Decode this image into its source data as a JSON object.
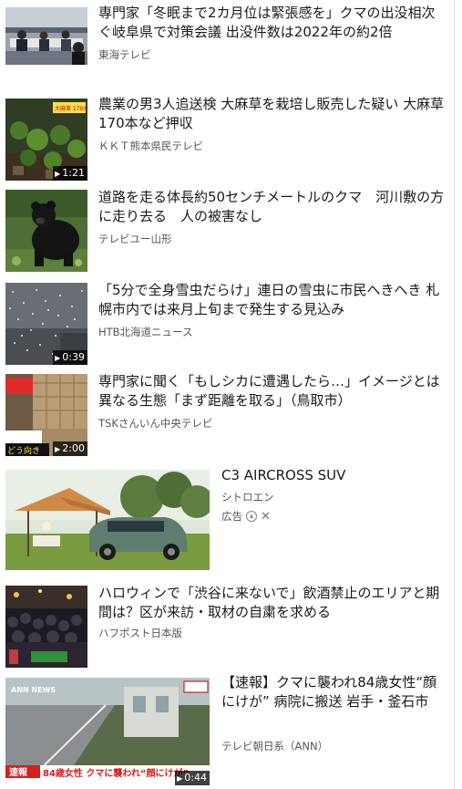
{
  "articles": [
    {
      "title": "専門家「冬眠まで2カ月位は緊張感を」クマの出没相次ぐ岐阜県で対策会議 出没件数は2022年の約2倍",
      "source": "東海テレビ",
      "duration": ""
    },
    {
      "title": "農業の男3人追送検 大麻草を栽培し販売した疑い 大麻草170本など押収",
      "source": "ＫＫＴ熊本県民テレビ",
      "duration": "1:21",
      "thumb_caption": "大麻草 170本押収"
    },
    {
      "title": "道路を走る体長約50センチメートルのクマ　河川敷の方に走り去る　人の被害なし",
      "source": "テレビユー山形",
      "duration": ""
    },
    {
      "title": "「5分で全身雪虫だらけ」連日の雪虫に市民へきへき 札幌市内では来月上旬まで発生する見込み",
      "source": "HTB北海道ニュース",
      "duration": "0:39"
    },
    {
      "title": "専門家に聞く「もしシカに遭遇したら…」イメージとは異なる生態「まず距離を取る」（鳥取市）",
      "source": "TSKさんいん中央テレビ",
      "duration": "2:00",
      "thumb_caption": "どう向き"
    },
    {
      "title": "ハロウィンで「渋谷に来ないで」飲酒禁止のエリアと期間は？区が来訪・取材の自粛を求める",
      "source": "ハフポスト日本版",
      "duration": ""
    },
    {
      "title": "【速報】クマに襲われ84歳女性“顔にけが” 病院に搬送 岩手・釜石市",
      "source": "テレビ朝日系（ANN）",
      "duration": "0:44",
      "thumb_caption": "84歳女性 クマに襲われ“顔にけが”",
      "thumb_badge": "速報",
      "thumb_logo": "ANN NEWS"
    }
  ],
  "ad": {
    "title": "C3 AIRCROSS SUV",
    "brand": "シトロエン",
    "label": "広告",
    "info_icon": "adchoices-icon",
    "close_icon": "close-icon"
  },
  "colors": {
    "title": "#1a1a1a",
    "source": "#555555",
    "divider": "#d9dbe1"
  }
}
